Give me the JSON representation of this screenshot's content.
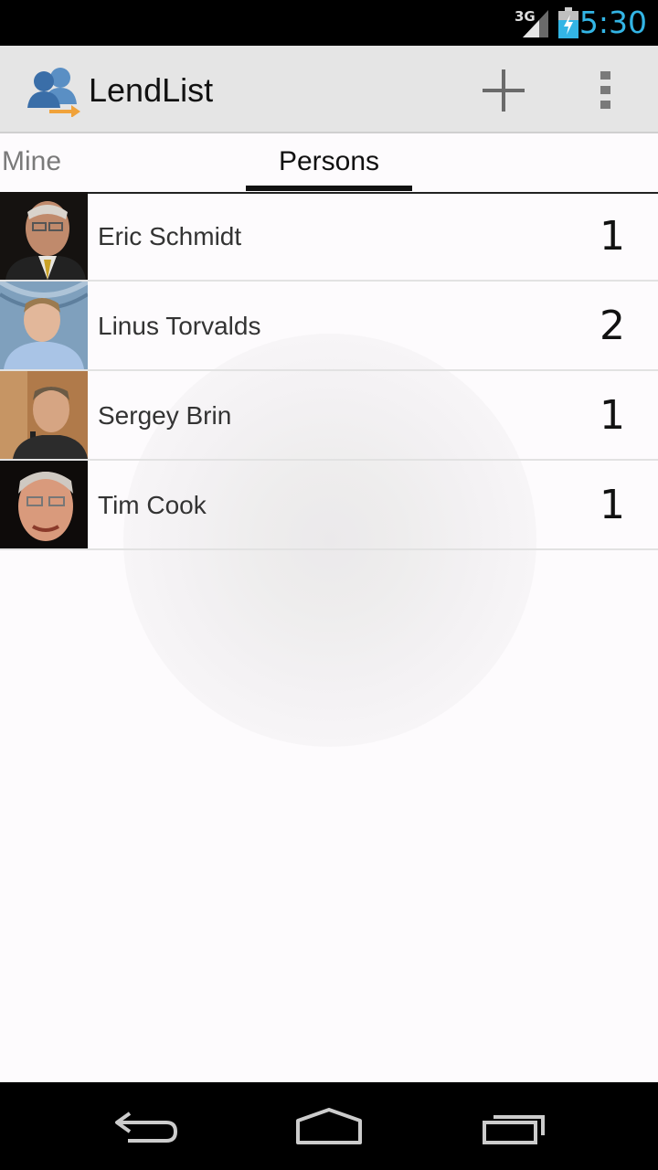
{
  "status_bar": {
    "network": "3G",
    "time": "5:30",
    "signal_icon": "signal-icon",
    "battery_icon": "battery-charging-icon"
  },
  "action_bar": {
    "title": "LendList",
    "app_icon": "people-transfer-icon",
    "add_icon": "plus-icon",
    "overflow_icon": "overflow-menu-icon"
  },
  "tabs": [
    {
      "label": "Mine",
      "selected": false
    },
    {
      "label": "Persons",
      "selected": true
    }
  ],
  "persons": [
    {
      "name": "Eric Schmidt",
      "count": "1"
    },
    {
      "name": "Linus Torvalds",
      "count": "2"
    },
    {
      "name": "Sergey Brin",
      "count": "1"
    },
    {
      "name": "Tim Cook",
      "count": "1"
    }
  ],
  "nav_bar": {
    "back_icon": "back-icon",
    "home_icon": "home-icon",
    "recents_icon": "recents-icon"
  },
  "colors": {
    "accent_clock": "#33b5e5",
    "action_bar_bg": "#e5e5e5",
    "background": "#fdfbfd"
  }
}
